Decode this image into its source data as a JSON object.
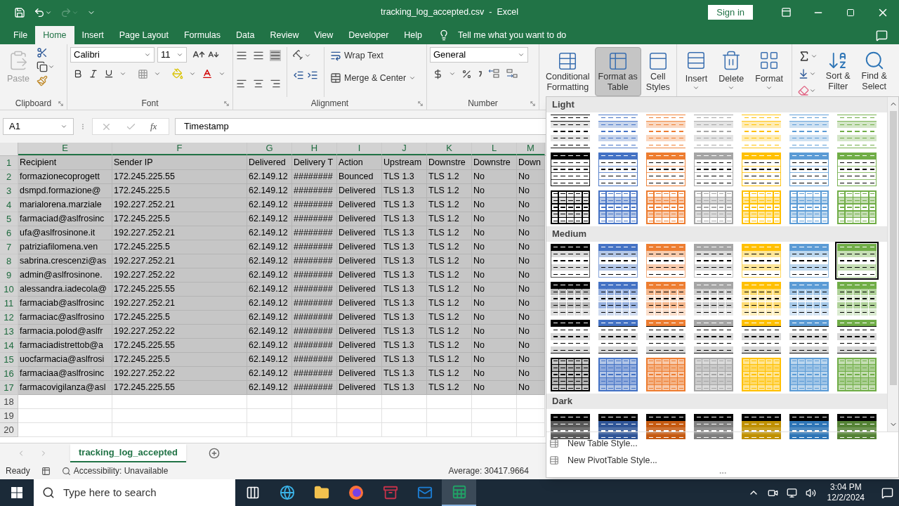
{
  "title_bar": {
    "title": "tracking_log_accepted.csv  -  Excel",
    "sign_in": "Sign in"
  },
  "menu_tabs": [
    {
      "label": "File",
      "selected": false
    },
    {
      "label": "Home",
      "selected": true
    },
    {
      "label": "Insert",
      "selected": false
    },
    {
      "label": "Page Layout",
      "selected": false
    },
    {
      "label": "Formulas",
      "selected": false
    },
    {
      "label": "Data",
      "selected": false
    },
    {
      "label": "Review",
      "selected": false
    },
    {
      "label": "View",
      "selected": false
    },
    {
      "label": "Developer",
      "selected": false
    },
    {
      "label": "Help",
      "selected": false
    }
  ],
  "tell_me": "Tell me what you want to do",
  "ribbon": {
    "clipboard": {
      "paste": "Paste",
      "label": "Clipboard"
    },
    "font": {
      "family": "Calibri",
      "size": "11",
      "label": "Font"
    },
    "alignment": {
      "wrap_text": "Wrap Text",
      "merge_center": "Merge & Center",
      "label": "Alignment"
    },
    "number": {
      "format": "General",
      "label": "Number"
    },
    "styles": [
      {
        "lines": [
          "Conditional",
          "Formatting"
        ],
        "selected": false
      },
      {
        "lines": [
          "Format as",
          "Table"
        ],
        "selected": true
      },
      {
        "lines": [
          "Cell",
          "Styles"
        ],
        "selected": false
      }
    ],
    "cells": [
      "Insert",
      "Delete",
      "Format"
    ],
    "editing": [
      {
        "lines": [
          "Sort &",
          "Filter"
        ]
      },
      {
        "lines": [
          "Find &",
          "Select"
        ]
      }
    ]
  },
  "formula_bar": {
    "name_box": "A1",
    "fx": "fx",
    "formula": "Timestamp"
  },
  "sheet": {
    "columns": [
      {
        "label": "E",
        "selected": true
      },
      {
        "label": "F",
        "selected": true
      },
      {
        "label": "G",
        "selected": true
      },
      {
        "label": "H",
        "selected": true
      },
      {
        "label": "I",
        "selected": true
      },
      {
        "label": "J",
        "selected": true
      },
      {
        "label": "K",
        "selected": true
      },
      {
        "label": "L",
        "selected": true
      },
      {
        "label": "M",
        "selected": true
      }
    ],
    "rows": [
      {
        "number": "1",
        "selected": true,
        "cells": [
          "Recipient",
          "Sender IP",
          "Delivered",
          "Delivery T",
          "Action",
          "Upstream",
          "Downstre",
          "Downstre",
          "Down"
        ]
      },
      {
        "number": "2",
        "selected": true,
        "cells": [
          "formazionecoprogett",
          "172.245.225.55",
          "62.149.12",
          "########",
          "Bounced",
          "TLS 1.3",
          "TLS 1.2",
          "No",
          "No"
        ]
      },
      {
        "number": "3",
        "selected": true,
        "cells": [
          "dsmpd.formazione@",
          "172.245.225.5",
          "62.149.12",
          "########",
          "Delivered",
          "TLS 1.3",
          "TLS 1.2",
          "No",
          "No"
        ]
      },
      {
        "number": "4",
        "selected": true,
        "cells": [
          "marialorena.marziale",
          "192.227.252.21",
          "62.149.12",
          "########",
          "Delivered",
          "TLS 1.3",
          "TLS 1.2",
          "No",
          "No"
        ]
      },
      {
        "number": "5",
        "selected": true,
        "cells": [
          "farmaciad@aslfrosinc",
          "172.245.225.5",
          "62.149.12",
          "########",
          "Delivered",
          "TLS 1.3",
          "TLS 1.2",
          "No",
          "No"
        ]
      },
      {
        "number": "6",
        "selected": true,
        "cells": [
          "ufa@aslfrosinone.it",
          "192.227.252.21",
          "62.149.12",
          "########",
          "Delivered",
          "TLS 1.3",
          "TLS 1.2",
          "No",
          "No"
        ]
      },
      {
        "number": "7",
        "selected": true,
        "cells": [
          "patriziafilomena.ven",
          "172.245.225.5",
          "62.149.12",
          "########",
          "Delivered",
          "TLS 1.3",
          "TLS 1.2",
          "No",
          "No"
        ]
      },
      {
        "number": "8",
        "selected": true,
        "cells": [
          "sabrina.crescenzi@as",
          "192.227.252.21",
          "62.149.12",
          "########",
          "Delivered",
          "TLS 1.3",
          "TLS 1.2",
          "No",
          "No"
        ]
      },
      {
        "number": "9",
        "selected": true,
        "cells": [
          "admin@aslfrosinone.",
          "192.227.252.22",
          "62.149.12",
          "########",
          "Delivered",
          "TLS 1.3",
          "TLS 1.2",
          "No",
          "No"
        ]
      },
      {
        "number": "10",
        "selected": true,
        "cells": [
          "alessandra.iadecola@",
          "172.245.225.55",
          "62.149.12",
          "########",
          "Delivered",
          "TLS 1.3",
          "TLS 1.2",
          "No",
          "No"
        ]
      },
      {
        "number": "11",
        "selected": true,
        "cells": [
          "farmaciab@aslfrosinc",
          "192.227.252.21",
          "62.149.12",
          "########",
          "Delivered",
          "TLS 1.3",
          "TLS 1.2",
          "No",
          "No"
        ]
      },
      {
        "number": "12",
        "selected": true,
        "cells": [
          "farmaciac@aslfrosino",
          "172.245.225.5",
          "62.149.12",
          "########",
          "Delivered",
          "TLS 1.3",
          "TLS 1.2",
          "No",
          "No"
        ]
      },
      {
        "number": "13",
        "selected": true,
        "cells": [
          "farmacia.polod@aslfr",
          "192.227.252.22",
          "62.149.12",
          "########",
          "Delivered",
          "TLS 1.3",
          "TLS 1.2",
          "No",
          "No"
        ]
      },
      {
        "number": "14",
        "selected": true,
        "cells": [
          "farmaciadistrettob@a",
          "172.245.225.55",
          "62.149.12",
          "########",
          "Delivered",
          "TLS 1.3",
          "TLS 1.2",
          "No",
          "No"
        ]
      },
      {
        "number": "15",
        "selected": true,
        "cells": [
          "uocfarmacia@aslfrosi",
          "172.245.225.5",
          "62.149.12",
          "########",
          "Delivered",
          "TLS 1.3",
          "TLS 1.2",
          "No",
          "No"
        ]
      },
      {
        "number": "16",
        "selected": true,
        "cells": [
          "farmaciaa@aslfrosinc",
          "192.227.252.22",
          "62.149.12",
          "########",
          "Delivered",
          "TLS 1.3",
          "TLS 1.2",
          "No",
          "No"
        ]
      },
      {
        "number": "17",
        "selected": true,
        "cells": [
          "farmacovigilanza@asl",
          "172.245.225.55",
          "62.149.12",
          "########",
          "Delivered",
          "TLS 1.3",
          "TLS 1.2",
          "No",
          "No"
        ]
      },
      {
        "number": "18",
        "selected": false,
        "cells": []
      },
      {
        "number": "19",
        "selected": false,
        "cells": []
      },
      {
        "number": "20",
        "selected": false,
        "cells": []
      }
    ]
  },
  "sheet_tabs": [
    {
      "label": "tracking_log_accepted",
      "selected": true
    }
  ],
  "status_bar": {
    "ready": "Ready",
    "accessibility": "Accessibility: Unavailable",
    "average": "Average: 30417.9664"
  },
  "gallery": {
    "sections": [
      {
        "label": "Light",
        "rows": [
          {
            "kind": "light-banded",
            "swatches": [
              {
                "color": "#000000",
                "selected": false
              },
              {
                "color": "#4472c4",
                "selected": false
              },
              {
                "color": "#ed7d31",
                "selected": false
              },
              {
                "color": "#a5a5a5",
                "selected": false
              },
              {
                "color": "#ffc000",
                "selected": false
              },
              {
                "color": "#5b9bd5",
                "selected": false
              },
              {
                "color": "#70ad47",
                "selected": false
              }
            ]
          },
          {
            "kind": "light-header",
            "swatches": [
              {
                "color": "#000000",
                "selected": false
              },
              {
                "color": "#4472c4",
                "selected": false
              },
              {
                "color": "#ed7d31",
                "selected": false
              },
              {
                "color": "#a5a5a5",
                "selected": false
              },
              {
                "color": "#ffc000",
                "selected": false
              },
              {
                "color": "#5b9bd5",
                "selected": false
              },
              {
                "color": "#70ad47",
                "selected": false
              }
            ]
          },
          {
            "kind": "light-grid",
            "swatches": [
              {
                "color": "#000000",
                "selected": false
              },
              {
                "color": "#4472c4",
                "selected": false
              },
              {
                "color": "#ed7d31",
                "selected": false
              },
              {
                "color": "#a5a5a5",
                "selected": false
              },
              {
                "color": "#ffc000",
                "selected": false
              },
              {
                "color": "#5b9bd5",
                "selected": false
              },
              {
                "color": "#70ad47",
                "selected": false
              }
            ]
          }
        ]
      },
      {
        "label": "Medium",
        "rows": [
          {
            "kind": "medium-header",
            "swatches": [
              {
                "color": "#000000",
                "selected": false
              },
              {
                "color": "#4472c4",
                "selected": false
              },
              {
                "color": "#ed7d31",
                "selected": false
              },
              {
                "color": "#a5a5a5",
                "selected": false
              },
              {
                "color": "#ffc000",
                "selected": false
              },
              {
                "color": "#5b9bd5",
                "selected": false
              },
              {
                "color": "#70ad47",
                "selected": true
              }
            ]
          },
          {
            "kind": "medium-banded-grid",
            "swatches": [
              {
                "color": "#000000",
                "selected": false
              },
              {
                "color": "#4472c4",
                "selected": false
              },
              {
                "color": "#ed7d31",
                "selected": false
              },
              {
                "color": "#a5a5a5",
                "selected": false
              },
              {
                "color": "#ffc000",
                "selected": false
              },
              {
                "color": "#5b9bd5",
                "selected": false
              },
              {
                "color": "#70ad47",
                "selected": false
              }
            ]
          },
          {
            "kind": "medium-topline",
            "swatches": [
              {
                "color": "#000000",
                "selected": false
              },
              {
                "color": "#4472c4",
                "selected": false
              },
              {
                "color": "#ed7d31",
                "selected": false
              },
              {
                "color": "#a5a5a5",
                "selected": false
              },
              {
                "color": "#ffc000",
                "selected": false
              },
              {
                "color": "#5b9bd5",
                "selected": false
              },
              {
                "color": "#70ad47",
                "selected": false
              }
            ]
          },
          {
            "kind": "medium-grid",
            "swatches": [
              {
                "color": "#000000",
                "selected": false
              },
              {
                "color": "#4472c4",
                "selected": false
              },
              {
                "color": "#ed7d31",
                "selected": false
              },
              {
                "color": "#a5a5a5",
                "selected": false
              },
              {
                "color": "#ffc000",
                "selected": false
              },
              {
                "color": "#5b9bd5",
                "selected": false
              },
              {
                "color": "#70ad47",
                "selected": false
              }
            ]
          }
        ]
      },
      {
        "label": "Dark",
        "rows": [
          {
            "kind": "dark",
            "swatches": [
              {
                "color": "#595959",
                "selected": false
              },
              {
                "color": "#2f5597",
                "selected": false
              },
              {
                "color": "#c55a11",
                "selected": false
              },
              {
                "color": "#7f7f7f",
                "selected": false
              },
              {
                "color": "#bf9000",
                "selected": false
              },
              {
                "color": "#2e75b6",
                "selected": false
              },
              {
                "color": "#548235",
                "selected": false
              }
            ]
          }
        ]
      }
    ],
    "actions": [
      "New Table Style...",
      "New PivotTable Style..."
    ]
  },
  "taskbar": {
    "search_placeholder": "Type here to search",
    "apps": [
      {
        "kind": "task-view",
        "selected": false
      },
      {
        "kind": "browser",
        "selected": false
      },
      {
        "kind": "folder",
        "selected": false
      },
      {
        "kind": "fox",
        "selected": false
      },
      {
        "kind": "archive",
        "selected": false
      },
      {
        "kind": "mail",
        "selected": false
      },
      {
        "kind": "spreadsheet",
        "selected": true
      }
    ],
    "time": "3:04 PM",
    "date": "12/2/2024"
  }
}
